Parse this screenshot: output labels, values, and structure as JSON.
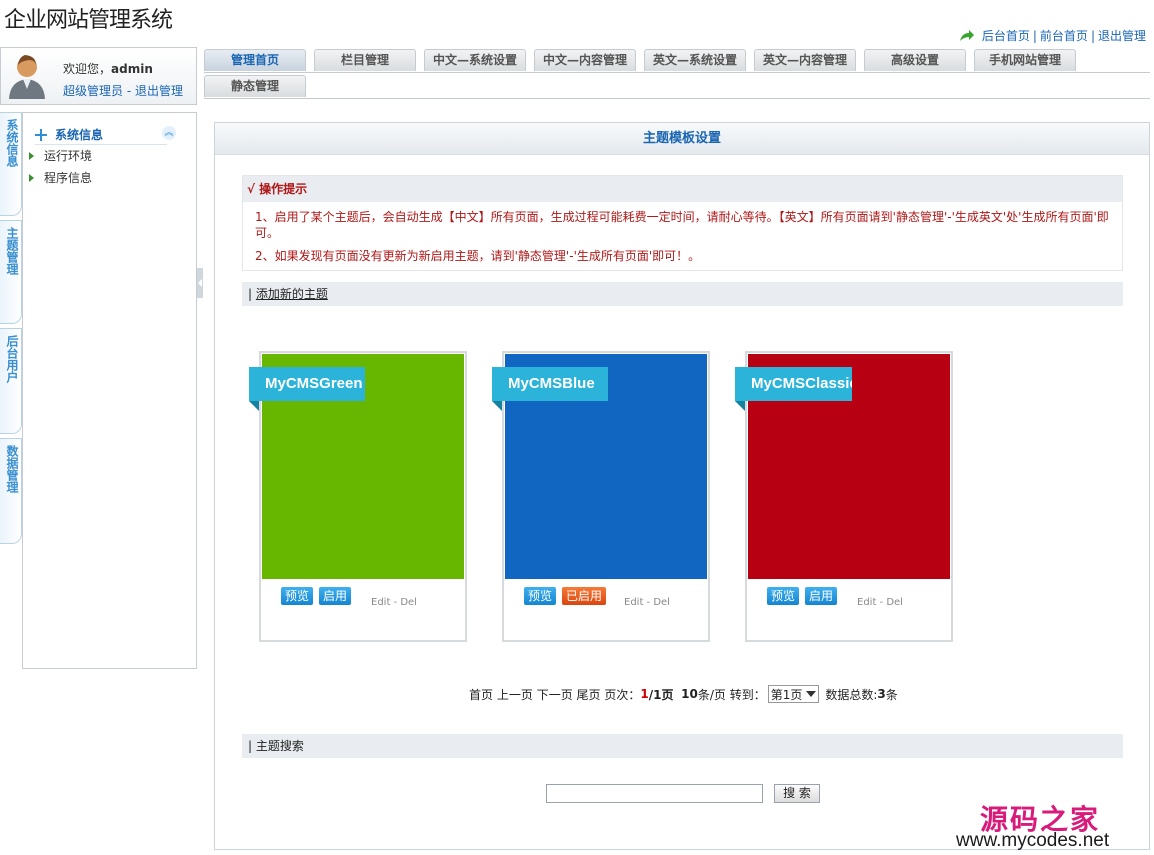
{
  "header": {
    "site_title": "企业网站管理系统",
    "links": [
      "后台首页",
      "前台首页",
      "退出管理"
    ],
    "separator": "|"
  },
  "user": {
    "welcome_prefix": "欢迎您，",
    "name": "admin",
    "role_link": "超级管理员",
    "dash": " - ",
    "logout_link": "退出管理"
  },
  "tabs": [
    "管理首页",
    "栏目管理",
    "中文—系统设置",
    "中文—内容管理",
    "英文—系统设置",
    "英文—内容管理",
    "高级设置",
    "手机网站管理",
    "静态管理"
  ],
  "vertical_tabs": [
    "系统信息",
    "主题管理",
    "后台用户",
    "数据管理"
  ],
  "left_menu": {
    "heading": "系统信息",
    "items": [
      "运行环境",
      "程序信息"
    ]
  },
  "main": {
    "panel_title": "主题模板设置",
    "tips": {
      "heading": "√ 操作提示",
      "line1": "1、启用了某个主题后，会自动生成【中文】所有页面，生成过程可能耗费一定时间，请耐心等待。【英文】所有页面请到'静态管理'-'生成英文'处'生成所有页面'即可。",
      "line2": "2、如果发现有页面没有更新为新启用主题，请到'静态管理'-'生成所有页面'即可！。"
    },
    "add_bar_prefix": "| ",
    "add_link": "添加新的主题",
    "themes": [
      {
        "name": "MyCMSGreen",
        "color": "#67b600",
        "preview": "预览",
        "status": "启用",
        "edit_del": "Edit - Del"
      },
      {
        "name": "MyCMSBlue",
        "color": "#1066c0",
        "preview": "预览",
        "status": "已启用",
        "edit_del": "Edit - Del"
      },
      {
        "name": "MyCMSClassic",
        "color": "#b70012",
        "preview": "预览",
        "status": "启用",
        "edit_del": "Edit - Del"
      }
    ],
    "pager": {
      "first": "首页",
      "prev": "上一页",
      "next": "下一页",
      "last": "尾页",
      "page_label": "页次：",
      "current": "1",
      "total_pages": "/1页",
      "per_page_num": "10",
      "per_page_text": "条/页",
      "goto_label": "转到：",
      "select_value": "第1页",
      "total_label": "数据总数:",
      "total_num": "3",
      "total_unit": "条"
    },
    "search_bar": "| 主题搜索",
    "search_button": "搜 索",
    "search_value": ""
  },
  "watermark": {
    "cn": "源码之家",
    "url": "www.mycodes.net"
  },
  "colors": {
    "accent": "#1a66b3",
    "warning": "#b01818",
    "ribbon": "#2bb3da",
    "enabled_badge": "#e45a1c"
  }
}
